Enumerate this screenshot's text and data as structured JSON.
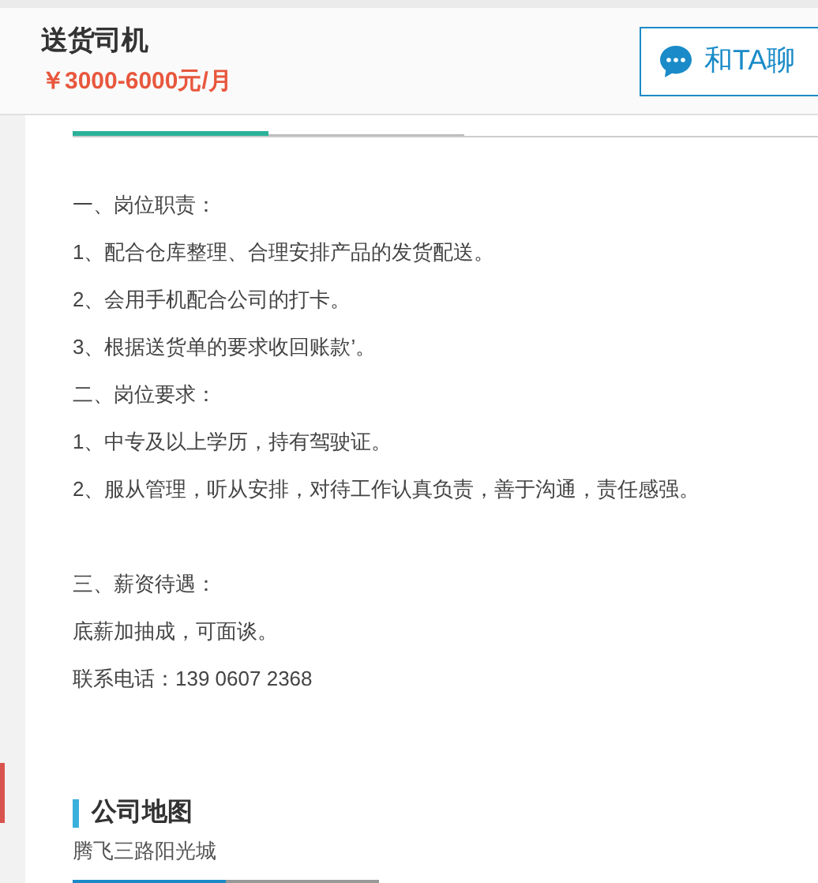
{
  "header": {
    "title": "送货司机",
    "salary": "￥3000-6000元/月",
    "chat_button": "和TA聊"
  },
  "tabs": [
    {
      "selected": true
    },
    {
      "selected": false
    }
  ],
  "description": [
    {
      "lines": [
        "一、岗位职责：",
        "1、配合仓库整理、合理安排产品的发货配送。",
        "2、会用手机配合公司的打卡。",
        "3、根据送货单的要求收回账款’。",
        "二、岗位要求：",
        "1、中专及以上学历，持有驾驶证。",
        "2、服从管理，听从安排，对待工作认真负责，善于沟通，责任感强。"
      ]
    },
    {
      "lines": [
        "三、薪资待遇：",
        "底薪加抽成，可面谈。",
        "联系电话：139 0607 2368"
      ]
    }
  ],
  "map_section": {
    "title": "公司地图",
    "address": "腾飞三路阳光城",
    "tabs": [
      {
        "selected": true
      },
      {
        "selected": false
      }
    ]
  }
}
